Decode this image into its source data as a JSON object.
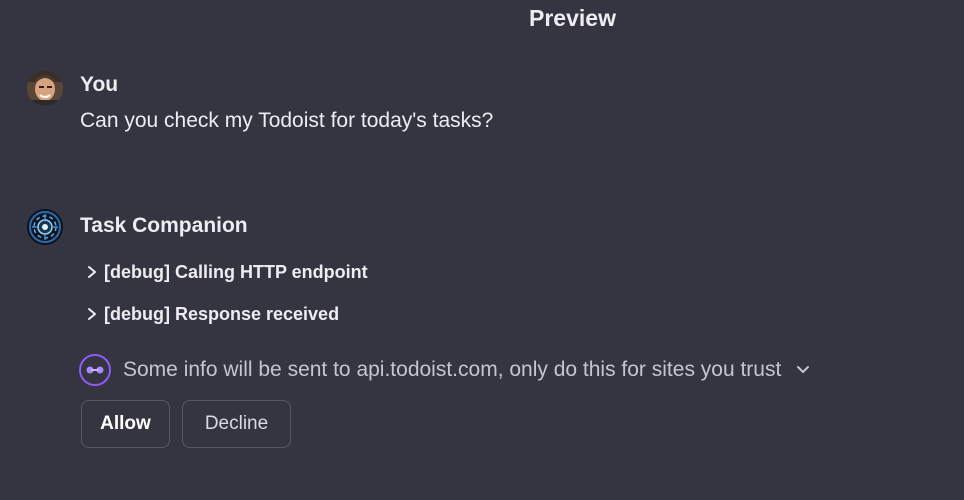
{
  "header": {
    "title": "Preview"
  },
  "conversation": {
    "user": {
      "name": "You",
      "message": "Can you check my Todoist for today's tasks?"
    },
    "assistant": {
      "name": "Task Companion",
      "debug_items": [
        {
          "label": "[debug] Calling HTTP endpoint"
        },
        {
          "label": "[debug] Response received"
        }
      ],
      "consent": {
        "text": "Some info will be sent to api.todoist.com, only do this for sites you trust"
      },
      "actions": {
        "allow_label": "Allow",
        "decline_label": "Decline"
      }
    }
  },
  "colors": {
    "background": "#343541",
    "text": "#ececf1",
    "muted_text": "#c5c5d2",
    "border": "#565869",
    "plugin_accent": "#8b5cf6"
  },
  "icons": {
    "user_avatar": "avatar",
    "assistant_avatar": "bot-avatar",
    "debug_chevron": "chevron-right-icon",
    "plugin_badge": "plugin-icon",
    "expand_chevron": "chevron-down-icon"
  }
}
